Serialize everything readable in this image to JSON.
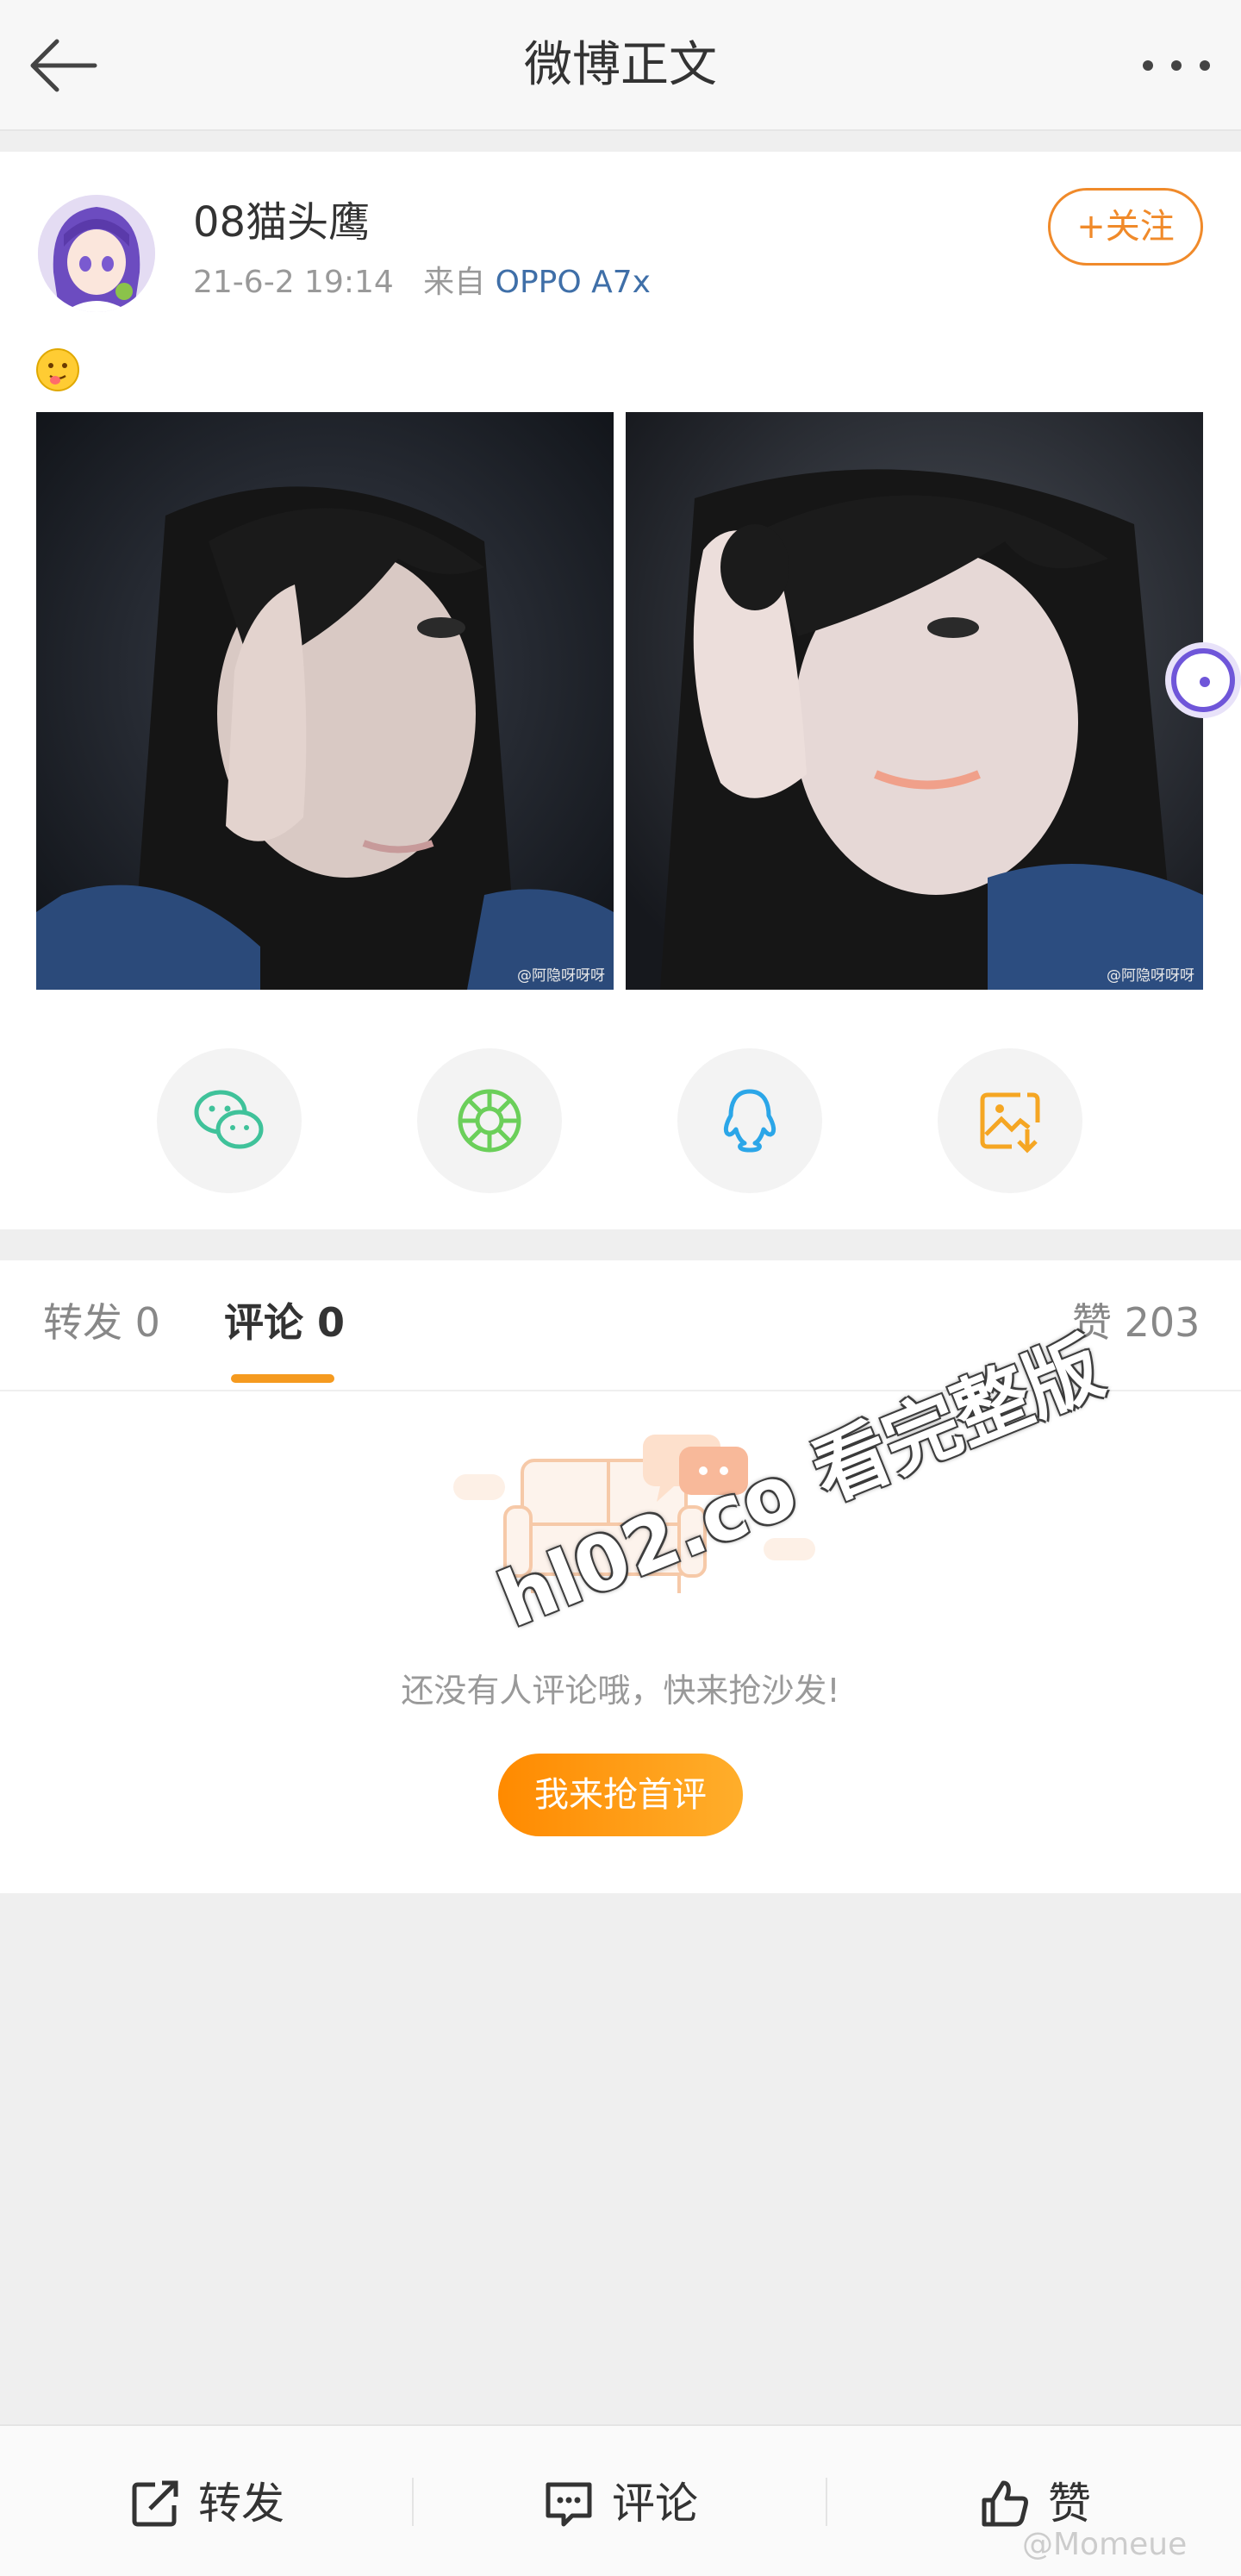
{
  "navbar": {
    "title": "微博正文"
  },
  "post": {
    "username": "08猫头鹰",
    "timestamp": "21-6-2 19:14",
    "source_prefix": "来自",
    "device": "OPPO A7x",
    "follow_label": "+关注",
    "photo_watermark": "@阿隐呀呀呀"
  },
  "share": {
    "items": [
      "wechat-icon",
      "moments-icon",
      "qq-icon",
      "save-image-icon"
    ],
    "colors": {
      "wechat": "#3fc29a",
      "moments": "#6bcf5a",
      "qq": "#2ba6e8",
      "save": "#f5a623"
    }
  },
  "tabs": {
    "repost": "转发 0",
    "comment": "评论 0",
    "like": "赞 203"
  },
  "empty": {
    "text": "还没有人评论哦，快来抢沙发!",
    "button": "我来抢首评"
  },
  "overlay": {
    "site_watermark": "hl02.co 看完整版"
  },
  "bottom_bar": {
    "repost": "转发",
    "comment": "评论",
    "like": "赞",
    "corner_mark": "@Momeue"
  },
  "colors": {
    "accent": "#f08a2a",
    "link": "#3f6fa8"
  }
}
